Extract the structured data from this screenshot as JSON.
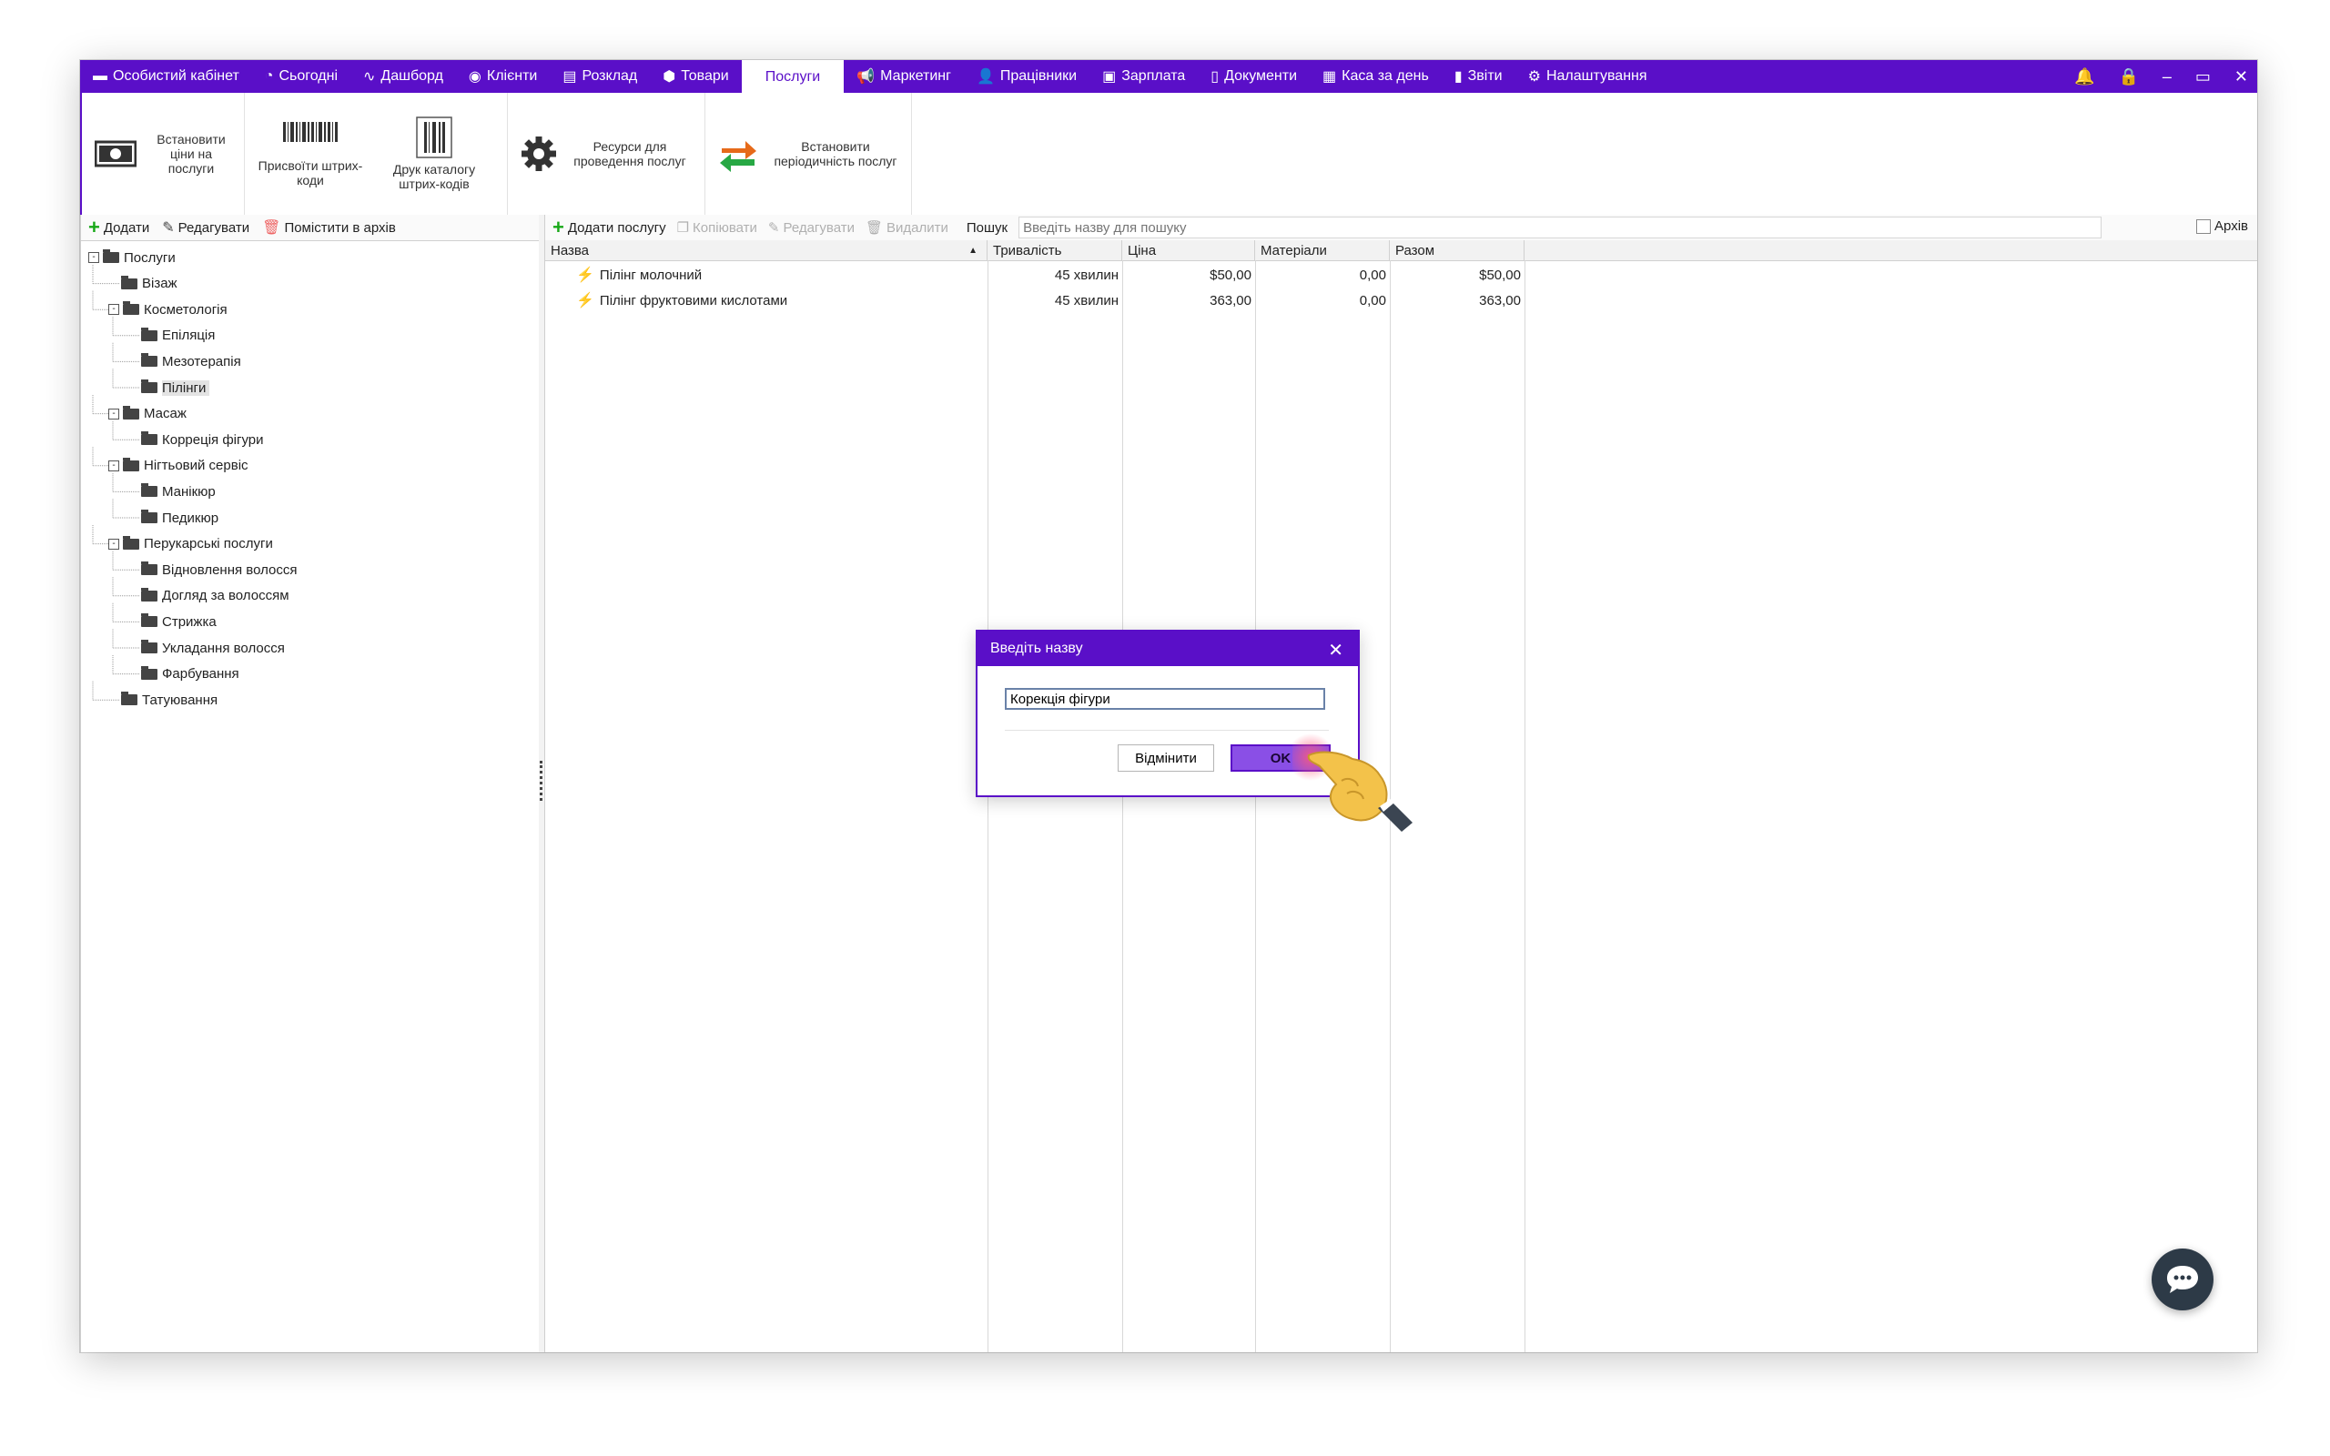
{
  "menubar": {
    "items": [
      {
        "label": "Особистий кабінет",
        "icon": "wallet-icon"
      },
      {
        "label": "Сьогодні",
        "icon": "clock-icon"
      },
      {
        "label": "Дашборд",
        "icon": "pulse-icon"
      },
      {
        "label": "Клієнти",
        "icon": "user-circle-icon"
      },
      {
        "label": "Розклад",
        "icon": "calendar-icon"
      },
      {
        "label": "Товари",
        "icon": "box-icon"
      },
      {
        "label": "Послуги",
        "icon": "",
        "active": true
      },
      {
        "label": "Маркетинг",
        "icon": "megaphone-icon"
      },
      {
        "label": "Працівники",
        "icon": "person-icon"
      },
      {
        "label": "Зарплата",
        "icon": "money-icon"
      },
      {
        "label": "Документи",
        "icon": "document-icon"
      },
      {
        "label": "Каса за день",
        "icon": "calculator-icon"
      },
      {
        "label": "Звіти",
        "icon": "bar-chart-icon"
      },
      {
        "label": "Налаштування",
        "icon": "gear-icon"
      }
    ],
    "accent_color": "#5a0fc8"
  },
  "ribbon": {
    "set_prices": "Встановити ціни на послуги",
    "assign_barcodes": "Присвоїти штрих-коди",
    "print_catalog": "Друк каталогу штрих-кодів",
    "resources": "Ресурси для проведення послуг",
    "periodicity": "Встановити періодичність послуг"
  },
  "left_toolbar": {
    "add": "Додати",
    "edit": "Редагувати",
    "archive": "Помістити в архів"
  },
  "tree": [
    {
      "label": "Послуги",
      "level": 0,
      "expander": "-"
    },
    {
      "label": "Візаж",
      "level": 1
    },
    {
      "label": "Косметологія",
      "level": 1,
      "expander": "-"
    },
    {
      "label": "Епіляція",
      "level": 2
    },
    {
      "label": "Мезотерапія",
      "level": 2
    },
    {
      "label": "Пілінги",
      "level": 2,
      "selected": true
    },
    {
      "label": "Масаж",
      "level": 1,
      "expander": "-"
    },
    {
      "label": "Корреція фігури",
      "level": 2
    },
    {
      "label": "Нігтьовий сервіс",
      "level": 1,
      "expander": "-"
    },
    {
      "label": "Манікюр",
      "level": 2
    },
    {
      "label": "Педикюр",
      "level": 2
    },
    {
      "label": "Перукарські послуги",
      "level": 1,
      "expander": "-"
    },
    {
      "label": "Відновлення волосся",
      "level": 2
    },
    {
      "label": "Догляд за волоссям",
      "level": 2
    },
    {
      "label": "Стрижка",
      "level": 2
    },
    {
      "label": "Укладання волосся",
      "level": 2
    },
    {
      "label": "Фарбування",
      "level": 2
    },
    {
      "label": "Татуювання",
      "level": 1
    }
  ],
  "right_toolbar": {
    "add_service": "Додати послугу",
    "copy": "Копіювати",
    "edit": "Редагувати",
    "delete": "Видалити",
    "search_label": "Пошук",
    "search_placeholder": "Введіть назву для пошуку",
    "archive_label": "Архів"
  },
  "grid": {
    "columns": [
      "Назва",
      "Тривалість",
      "Ціна",
      "Матеріали",
      "Разом"
    ],
    "rows": [
      {
        "name": "Пілінг молочний",
        "duration": "45 хвилин",
        "price": "$50,00",
        "materials": "0,00",
        "total": "$50,00"
      },
      {
        "name": "Пілінг фруктовими кислотами",
        "duration": "45 хвилин",
        "price": "363,00",
        "materials": "0,00",
        "total": "363,00"
      }
    ]
  },
  "dialog": {
    "title": "Введіть назву",
    "input_value": "Корекція фігури",
    "cancel": "Відмінити",
    "ok": "OK"
  }
}
